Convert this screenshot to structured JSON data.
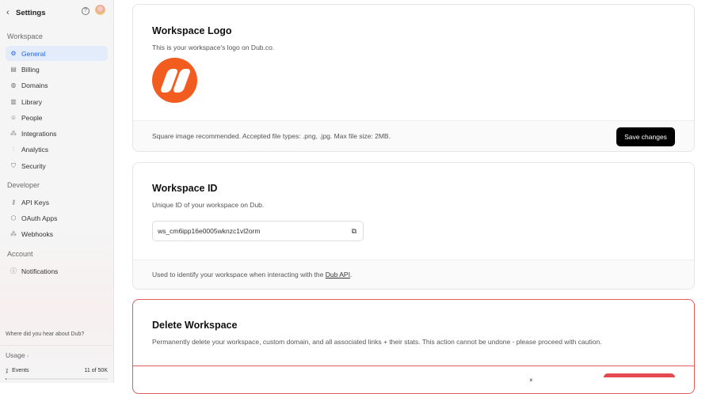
{
  "sidebar": {
    "title": "Settings",
    "sections": [
      "Workspace",
      "Developer",
      "Account"
    ],
    "workspace_items": [
      {
        "label": "General",
        "icon": "gear-icon"
      },
      {
        "label": "Billing",
        "icon": "receipt-icon"
      },
      {
        "label": "Domains",
        "icon": "globe-icon"
      },
      {
        "label": "Library",
        "icon": "library-icon"
      },
      {
        "label": "People",
        "icon": "users-icon"
      },
      {
        "label": "Integrations",
        "icon": "integrations-icon"
      },
      {
        "label": "Analytics",
        "icon": "chart-icon"
      },
      {
        "label": "Security",
        "icon": "shield-icon"
      }
    ],
    "developer_items": [
      {
        "label": "API Keys",
        "icon": "key-icon"
      },
      {
        "label": "OAuth Apps",
        "icon": "cube-icon"
      },
      {
        "label": "Webhooks",
        "icon": "webhook-icon"
      }
    ],
    "account_items": [
      {
        "label": "Notifications",
        "icon": "info-icon"
      }
    ],
    "hear_about": "Where did you hear about Dub?",
    "usage_label": "Usage",
    "events_label": "Events",
    "events_count": "11 of 50K",
    "events_fraction": 0.0002
  },
  "logo_card": {
    "title": "Workspace Logo",
    "description": "This is your workspace's logo on Dub.co.",
    "footer": "Square image recommended. Accepted file types: .png, .jpg. Max file size: 2MB.",
    "save_label": "Save changes"
  },
  "id_card": {
    "title": "Workspace ID",
    "description": "Unique ID of your workspace on Dub.",
    "workspace_id": "ws_cm6ipp16e0005wknzc1vl2orm",
    "footer_prefix": "Used to identify your workspace when interacting with the ",
    "footer_link": "Dub API",
    "footer_suffix": "."
  },
  "delete_card": {
    "title": "Delete Workspace",
    "description": "Permanently delete your workspace, custom domain, and all associated links + their stats. This action cannot be undone - please proceed with caution."
  },
  "toast": {
    "close": "×"
  }
}
